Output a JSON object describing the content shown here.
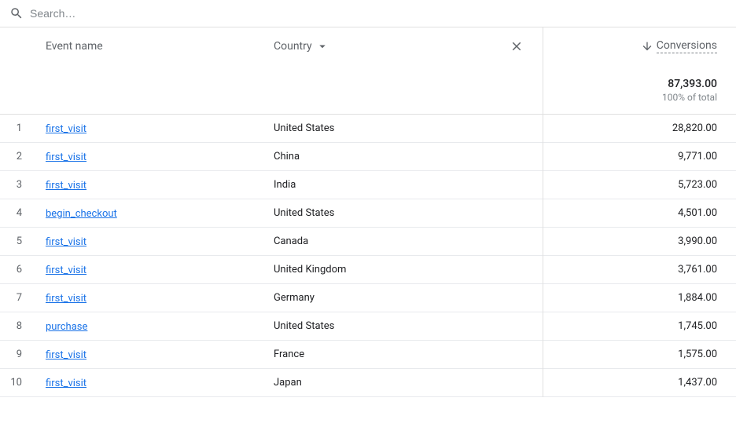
{
  "search": {
    "placeholder": "Search…"
  },
  "columns": {
    "event_name": "Event name",
    "country": "Country",
    "conversions": "Conversions"
  },
  "summary": {
    "total": "87,393.00",
    "percent": "100% of total"
  },
  "rows": [
    {
      "idx": "1",
      "event": "first_visit",
      "country": "United States",
      "value": "28,820.00"
    },
    {
      "idx": "2",
      "event": "first_visit",
      "country": "China",
      "value": "9,771.00"
    },
    {
      "idx": "3",
      "event": "first_visit",
      "country": "India",
      "value": "5,723.00"
    },
    {
      "idx": "4",
      "event": "begin_checkout",
      "country": "United States",
      "value": "4,501.00"
    },
    {
      "idx": "5",
      "event": "first_visit",
      "country": "Canada",
      "value": "3,990.00"
    },
    {
      "idx": "6",
      "event": "first_visit",
      "country": "United Kingdom",
      "value": "3,761.00"
    },
    {
      "idx": "7",
      "event": "first_visit",
      "country": "Germany",
      "value": "1,884.00"
    },
    {
      "idx": "8",
      "event": "purchase",
      "country": "United States",
      "value": "1,745.00"
    },
    {
      "idx": "9",
      "event": "first_visit",
      "country": "France",
      "value": "1,575.00"
    },
    {
      "idx": "10",
      "event": "first_visit",
      "country": "Japan",
      "value": "1,437.00"
    }
  ]
}
